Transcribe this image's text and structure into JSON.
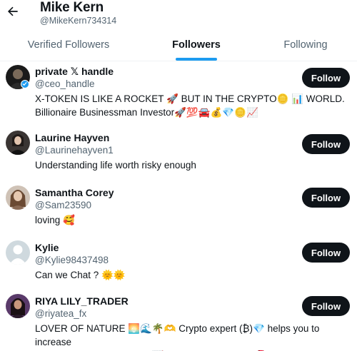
{
  "header": {
    "name": "Mike Kern",
    "handle": "@MikeKern734314"
  },
  "tabs": [
    {
      "label": "Verified Followers"
    },
    {
      "label": "Followers"
    },
    {
      "label": "Following"
    }
  ],
  "active_tab": "Followers",
  "users": [
    {
      "name": "private 𝕏 handle",
      "handle": "@ceo_handle",
      "bio": "X-TOKEN IS LIKE A ROCKET 🚀 BUT IN THE CRYPTO🪙 📊 WORLD.\nBillionaire Businessman Investor🚀💯🚘💰💎🪙📈",
      "follow_label": "Follow",
      "verified": true
    },
    {
      "name": "Laurine Hayven",
      "handle": "@Laurinehayven1",
      "bio": "Understanding life worth risky enough",
      "follow_label": "Follow"
    },
    {
      "name": "Samantha Corey",
      "handle": "@Sam23590",
      "bio": "loving 🥰",
      "follow_label": "Follow"
    },
    {
      "name": "Kylie",
      "handle": "@Kylie98437498",
      "bio": "Can we Chat ? 🌞🌞",
      "follow_label": "Follow"
    },
    {
      "name": "RIYA LILY_TRADER",
      "handle": "@riyatea_fx",
      "bio": "LOVER OF NATURE 🌅🌊🌴🫶 Crypto expert (₿)💎 helps you to increase\nand make passive income. 📈 DM to get started.🇺🇸🌹",
      "follow_label": "Follow"
    }
  ],
  "colors": {
    "accent": "#1d9bf0",
    "button_bg": "#0f1419",
    "secondary_text": "#536471"
  }
}
